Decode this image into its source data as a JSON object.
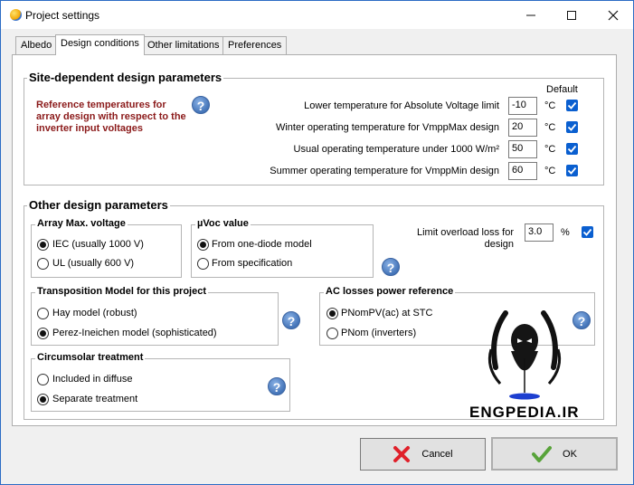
{
  "window": {
    "title": "Project settings"
  },
  "tabs": [
    "Albedo",
    "Design conditions",
    "Other limitations",
    "Preferences"
  ],
  "site": {
    "title": "Site-dependent design parameters",
    "reference_text": "Reference temperatures for array design with respect to the inverter input voltages",
    "default_header": "Default",
    "rows": [
      {
        "label": "Lower temperature for Absolute Voltage limit",
        "value": "-10",
        "unit": "°C"
      },
      {
        "label": "Winter operating temperature for VmppMax design",
        "value": "20",
        "unit": "°C"
      },
      {
        "label": "Usual operating temperature under 1000 W/m²",
        "value": "50",
        "unit": "°C"
      },
      {
        "label": "Summer operating temperature for VmppMin design",
        "value": "60",
        "unit": "°C"
      }
    ]
  },
  "other": {
    "title": "Other design parameters",
    "array_voltage": {
      "title": "Array Max. voltage",
      "options": [
        "IEC (usually 1000 V)",
        "UL (usually 600 V)"
      ]
    },
    "muvoc": {
      "title": "µVoc value",
      "options": [
        "From one-diode model",
        "From specification"
      ]
    },
    "overload": {
      "label_line1": "Limit overload loss for",
      "label_line2": "design",
      "value": "3.0",
      "unit": "%"
    },
    "transposition": {
      "title": "Transposition Model for this project",
      "options": [
        "Hay model (robust)",
        "Perez-Ineichen model (sophisticated)"
      ]
    },
    "ac_losses": {
      "title": "AC losses power reference",
      "options": [
        "PNomPV(ac) at STC",
        "PNom (inverters)"
      ]
    },
    "circumsolar": {
      "title": "Circumsolar treatment",
      "options": [
        "Included in diffuse",
        "Separate treatment"
      ]
    }
  },
  "watermark": {
    "text": "ENGPEDIA.IR"
  },
  "buttons": {
    "cancel": "Cancel",
    "ok": "OK"
  },
  "help_glyph": "?",
  "colors": {
    "accent": "#0a5fd0",
    "reference_text": "#8b1a1a",
    "cancel_icon": "#e0202a",
    "ok_icon": "#58a33a"
  }
}
